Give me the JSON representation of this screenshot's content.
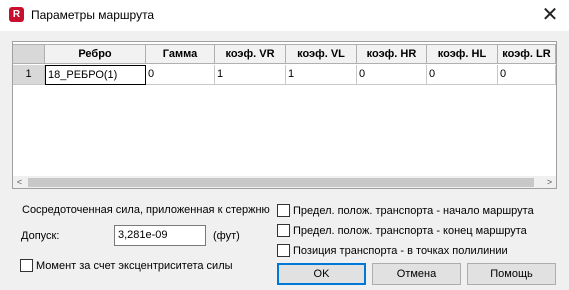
{
  "window": {
    "title": "Параметры маршрута",
    "app_icon_letter": "R",
    "close_glyph": "✕"
  },
  "grid": {
    "columns": [
      "Ребро",
      "Гамма",
      "коэф. VR",
      "коэф. VL",
      "коэф. HR",
      "коэф. HL",
      "коэф. LR"
    ],
    "rows": [
      {
        "num": "1",
        "cells": [
          "18_РЕБРО(1)",
          "0",
          "1",
          "1",
          "0",
          "0",
          "0"
        ]
      }
    ],
    "scroll_left_glyph": "<",
    "scroll_right_glyph": ">"
  },
  "force": {
    "group_label": "Сосредоточенная сила, приложенная к стержню",
    "tolerance_label": "Допуск:",
    "tolerance_value": "3,281e-09",
    "tolerance_unit": "(фут)",
    "moment_label": "Момент за счет эксцентриситета силы"
  },
  "options": {
    "start_label": "Предел. полож. транспорта - начало маршрута",
    "end_label": "Предел. полож. транспорта - конец маршрута",
    "position_label": "Позиция транспорта - в точках полилинии"
  },
  "buttons": {
    "ok": "OK",
    "cancel": "Отмена",
    "help": "Помощь"
  },
  "colors": {
    "accent": "#0078d7",
    "app_icon": "#c8102e"
  }
}
